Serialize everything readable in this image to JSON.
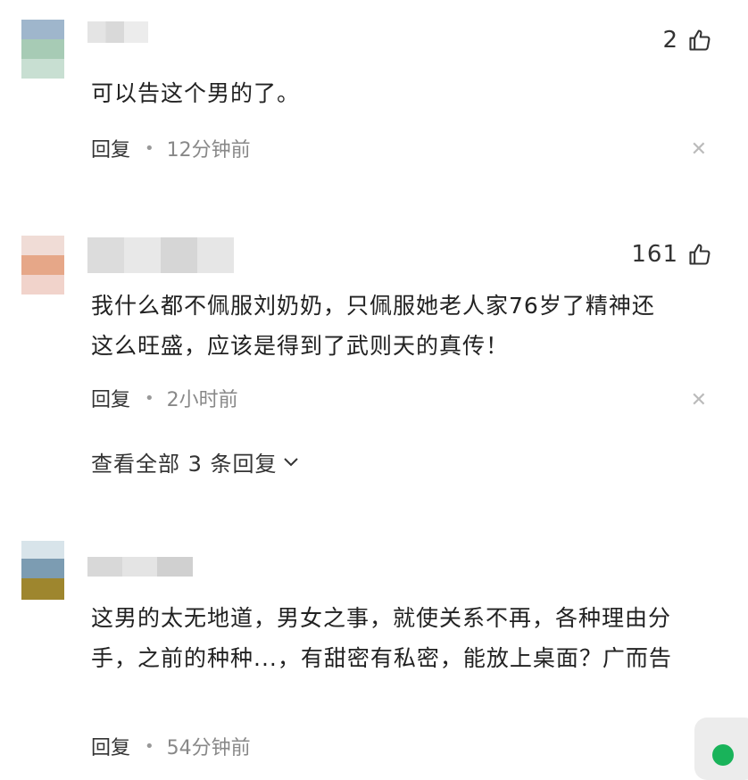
{
  "comments": [
    {
      "likes": "2",
      "text": "可以告这个男的了。",
      "reply_label": "回复",
      "time": "12分钟前"
    },
    {
      "likes": "161",
      "text_line1": "我什么都不佩服刘奶奶，只佩服她老人家76岁了精神还",
      "text_line2": "这么旺盛，应该是得到了武则天的真传！",
      "reply_label": "回复",
      "time": "2小时前",
      "view_replies": "查看全部 3 条回复"
    },
    {
      "text_line1": "这男的太无地道，男女之事，就使关系不再，各种理由分",
      "text_line2": "手，之前的种种...，有甜密有私密，能放上桌面？广而告",
      "reply_label": "回复",
      "time": "54分钟前"
    }
  ],
  "icons": {
    "like": "thumbs-up-icon",
    "close": "close-icon",
    "chevron": "chevron-down-icon"
  },
  "colors": {
    "fab_dot": "#19b35a"
  }
}
